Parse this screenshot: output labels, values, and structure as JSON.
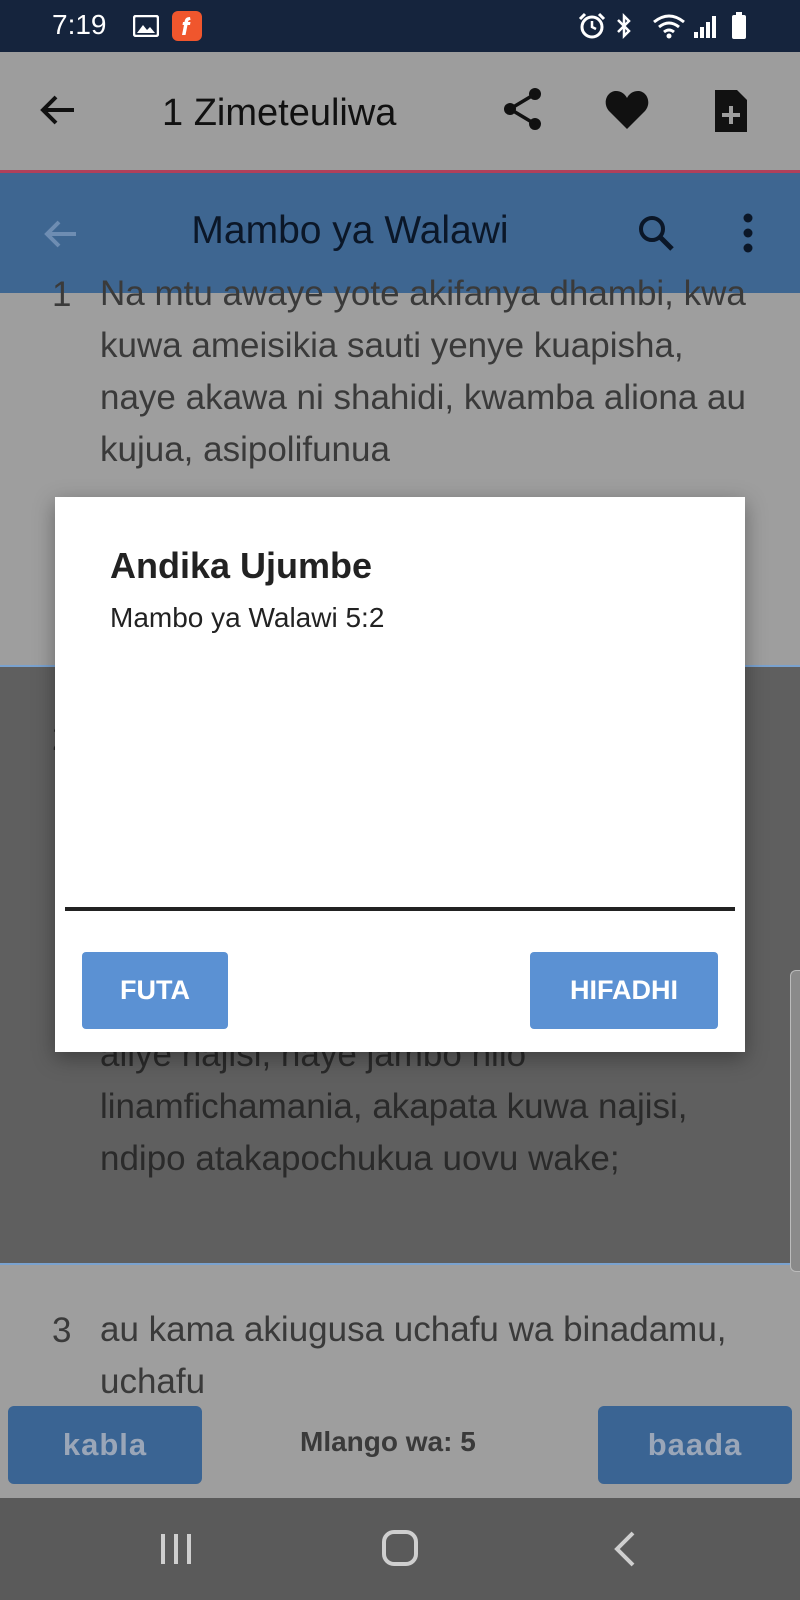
{
  "status_bar": {
    "time": "7:19"
  },
  "selection_toolbar": {
    "title": "1 Zimeteuliwa"
  },
  "app_bar": {
    "title": "Mambo ya Walawi"
  },
  "verses": [
    {
      "number": "1",
      "text": "Na mtu awaye yote akifanya dhambi, kwa kuwa ameisikia sauti yenye kuapisha, naye akawa ni shahidi, kwamba aliona au kujua, asipolifunua"
    },
    {
      "number": "2",
      "text": "aliye najisi, naye jambo hilo linamfichamania, akapata kuwa najisi, ndipo atakapochukua uovu wake;"
    },
    {
      "number": "3",
      "text": "au kama akiugusa uchafu wa binadamu, uchafu"
    }
  ],
  "bottom_bar": {
    "prev_label": "kabla",
    "chapter_label": "Mlango wa: 5",
    "next_label": "baada"
  },
  "dialog": {
    "title": "Andika Ujumbe",
    "subtitle": "Mambo ya Walawi 5:2",
    "note_value": "",
    "delete_label": "FUTA",
    "save_label": "HIFADHI"
  },
  "colors": {
    "status_bar": "#15243d",
    "app_bar": "#3e6691",
    "toolbar_accent": "#b0405a",
    "dialog_button": "#5b91d3",
    "nav_button": "#3a6493"
  }
}
